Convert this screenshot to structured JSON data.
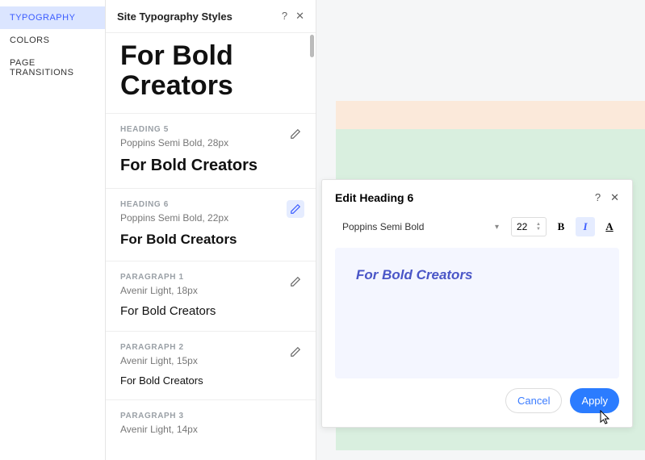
{
  "nav": {
    "items": [
      "TYPOGRAPHY",
      "COLORS",
      "PAGE TRANSITIONS"
    ],
    "active": 0
  },
  "panel": {
    "title": "Site Typography Styles"
  },
  "bigSample": "For Bold Creators",
  "styles": [
    {
      "label": "HEADING 5",
      "meta": "Poppins Semi Bold, 28px",
      "sample": "For Bold Creators",
      "cls": "h5",
      "active": false
    },
    {
      "label": "HEADING 6",
      "meta": "Poppins Semi Bold, 22px",
      "sample": "For Bold Creators",
      "cls": "h6",
      "active": true
    },
    {
      "label": "PARAGRAPH 1",
      "meta": "Avenir Light, 18px",
      "sample": "For Bold Creators",
      "cls": "p1",
      "active": false
    },
    {
      "label": "PARAGRAPH 2",
      "meta": "Avenir Light, 15px",
      "sample": "For Bold Creators",
      "cls": "p2",
      "active": false
    },
    {
      "label": "PARAGRAPH 3",
      "meta": "Avenir Light, 14px",
      "sample": "",
      "cls": "",
      "active": false
    }
  ],
  "modal": {
    "title": "Edit Heading 6",
    "font": "Poppins Semi Bold",
    "size": "22",
    "bold": "B",
    "italic": "I",
    "underline": "A",
    "preview": "For Bold Creators",
    "cancel": "Cancel",
    "apply": "Apply"
  }
}
